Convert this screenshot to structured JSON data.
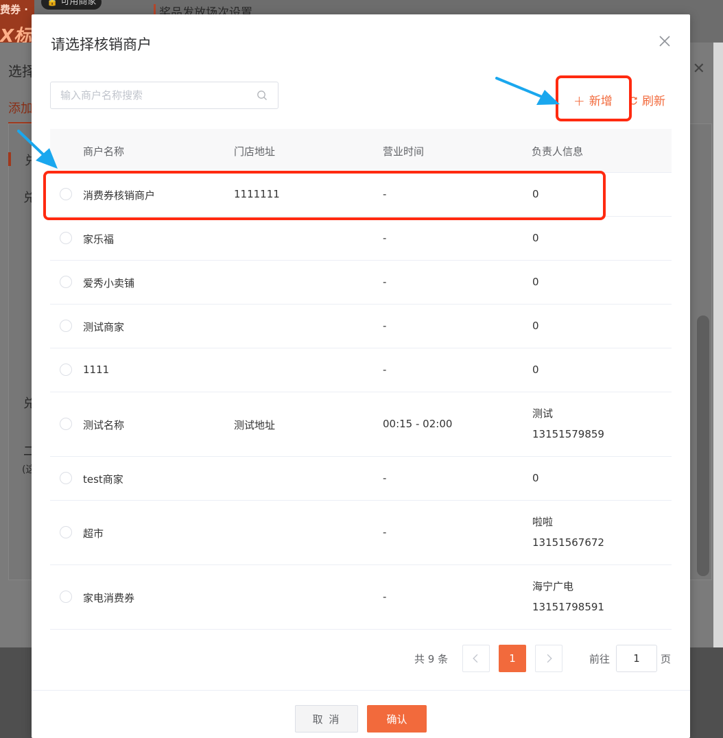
{
  "background": {
    "banner_text": "费券 ·",
    "banner_big": "X标",
    "pill_label": "可用商家",
    "page_title": "奖品发放场次设置",
    "dialog_title_fragment": "选择",
    "tab_fragment": "添加",
    "label_fragments": [
      "兑",
      "兑",
      "兑",
      "二",
      "(这"
    ]
  },
  "modal": {
    "title": "请选择核销商户",
    "search_placeholder": "输入商户名称搜索",
    "add_label": "新增",
    "refresh_label": "刷新",
    "columns": [
      "商户名称",
      "门店地址",
      "营业时间",
      "负责人信息"
    ],
    "rows": [
      {
        "name": "消费券核销商户",
        "address": "1111111",
        "hours": "-",
        "contact": "0",
        "contact2": ""
      },
      {
        "name": "家乐福",
        "address": "",
        "hours": "-",
        "contact": "0",
        "contact2": ""
      },
      {
        "name": "爱秀小卖铺",
        "address": "",
        "hours": "-",
        "contact": "0",
        "contact2": ""
      },
      {
        "name": "测试商家",
        "address": "",
        "hours": "-",
        "contact": "0",
        "contact2": ""
      },
      {
        "name": "1111",
        "address": "",
        "hours": "-",
        "contact": "0",
        "contact2": ""
      },
      {
        "name": "测试名称",
        "address": "测试地址",
        "hours": "00:15 - 02:00",
        "contact": "测试",
        "contact2": "13151579859"
      },
      {
        "name": "test商家",
        "address": "",
        "hours": "-",
        "contact": "0",
        "contact2": ""
      },
      {
        "name": "超市",
        "address": "",
        "hours": "-",
        "contact": "啦啦",
        "contact2": "13151567672"
      },
      {
        "name": "家电消费券",
        "address": "",
        "hours": "-",
        "contact": "海宁广电",
        "contact2": "13151798591"
      }
    ],
    "pagination": {
      "total_label": "共 9 条",
      "current_page": "1",
      "goto_label": "前往",
      "goto_value": "1",
      "page_suffix": "页"
    },
    "cancel_label": "取 消",
    "ok_label": "确认"
  },
  "colors": {
    "accent": "#f26a3c",
    "annotation_box": "#ff2a10",
    "annotation_arrow": "#1aa7ee"
  }
}
